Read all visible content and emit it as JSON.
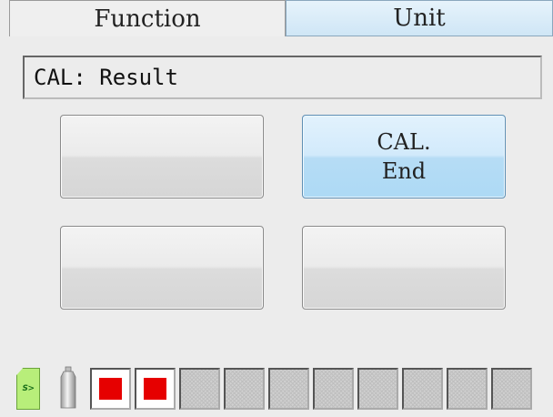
{
  "tabs": [
    {
      "label": "Function",
      "selected": true
    },
    {
      "label": "Unit",
      "selected": false
    }
  ],
  "status": {
    "text": "CAL: Result"
  },
  "buttons": [
    {
      "label": "",
      "active": false
    },
    {
      "label": "CAL.\nEnd",
      "active": true
    },
    {
      "label": "",
      "active": false
    },
    {
      "label": "",
      "active": false
    }
  ],
  "bottom_bar": {
    "sd_card_label": "S>",
    "sd_icon": "sd-card-icon",
    "bottle_icon": "gas-bottle-icon",
    "slots": [
      {
        "state": "filled",
        "color": "#e60000"
      },
      {
        "state": "filled",
        "color": "#e60000"
      },
      {
        "state": "empty"
      },
      {
        "state": "empty"
      },
      {
        "state": "empty"
      },
      {
        "state": "empty"
      },
      {
        "state": "empty"
      },
      {
        "state": "empty"
      },
      {
        "state": "empty"
      },
      {
        "state": "empty"
      }
    ]
  },
  "colors": {
    "active_button": "#b6dcf5",
    "slot_filled": "#e60000",
    "sd_card": "#b8ee7a"
  }
}
